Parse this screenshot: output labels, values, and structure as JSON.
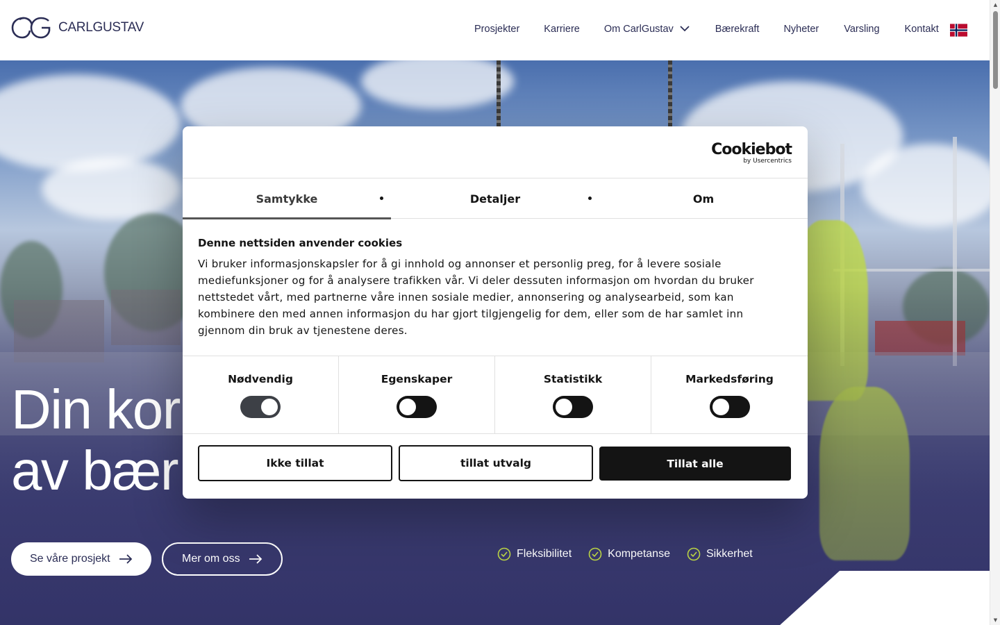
{
  "header": {
    "logo_text": "CARLGUSTAV",
    "nav": [
      {
        "label": "Prosjekter"
      },
      {
        "label": "Karriere"
      },
      {
        "label": "Om CarlGustav"
      },
      {
        "label": "Bærekraft"
      },
      {
        "label": "Nyheter"
      },
      {
        "label": "Varsling"
      },
      {
        "label": "Kontakt"
      }
    ],
    "language_flag": "norway-flag-icon"
  },
  "hero": {
    "title_line1": "Din kor",
    "title_line2": "av bær",
    "primary_button": "Se våre prosjekt",
    "secondary_button": "Mer om oss",
    "features": [
      "Fleksibilitet",
      "Kompetanse",
      "Sikkerhet"
    ]
  },
  "cookie_dialog": {
    "brand": "Cookiebot",
    "brand_sub": "by Usercentrics",
    "tabs": [
      {
        "label": "Samtykke",
        "active": true
      },
      {
        "label": "Detaljer",
        "active": false
      },
      {
        "label": "Om",
        "active": false
      }
    ],
    "heading": "Denne nettsiden anvender cookies",
    "body": "Vi bruker informasjonskapsler for å gi innhold og annonser et personlig preg, for å levere sosiale mediefunksjoner og for å analysere trafikken vår. Vi deler dessuten informasjon om hvordan du bruker nettstedet vårt, med partnerne våre innen sosiale medier, annonsering og analysearbeid, som kan kombinere den med annen informasjon du har gjort tilgjengelig for dem, eller som de har samlet inn gjennom din bruk av tjenestene deres.",
    "toggles": [
      {
        "label": "Nødvendig",
        "on": true
      },
      {
        "label": "Egenskaper",
        "on": false
      },
      {
        "label": "Statistikk",
        "on": false
      },
      {
        "label": "Markedsføring",
        "on": false
      }
    ],
    "buttons": {
      "deny": "Ikke tillat",
      "selection": "tillat utvalg",
      "allow_all": "Tillat alle"
    }
  },
  "colors": {
    "brand_navy": "#2b2d55",
    "dialog_dark": "#141414",
    "hero_overlay": "#3c3d72",
    "worker_vest": "#bed846"
  }
}
